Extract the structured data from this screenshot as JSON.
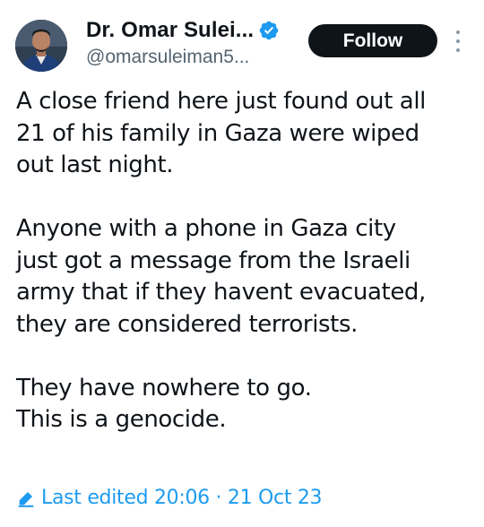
{
  "author": {
    "display_name": "Dr. Omar Sulei...",
    "handle": "@omarsuleiman5...",
    "verified_icon": "verified-badge-icon",
    "avatar": "avatar"
  },
  "actions": {
    "follow_label": "Follow",
    "more_icon": "more-options-icon"
  },
  "tweet": {
    "paragraphs": [
      {
        "lines": [
          "A close friend here just found out all",
          "21 of his family in Gaza were wiped",
          "out last night."
        ]
      },
      {
        "lines": [
          "Anyone with a phone in Gaza city",
          "just got a message from the Israeli",
          "army that if they havent evacuated,",
          "they are considered terrorists."
        ]
      },
      {
        "lines": [
          "They have nowhere to go.",
          "This is a genocide."
        ]
      }
    ],
    "edited": {
      "icon": "pencil-icon",
      "text": "Last edited 20:06 · 21 Oct 23"
    }
  },
  "colors": {
    "accent": "#1d9bf0",
    "text": "#0f1419",
    "secondary": "#536471",
    "follow_bg": "#0f1419"
  }
}
